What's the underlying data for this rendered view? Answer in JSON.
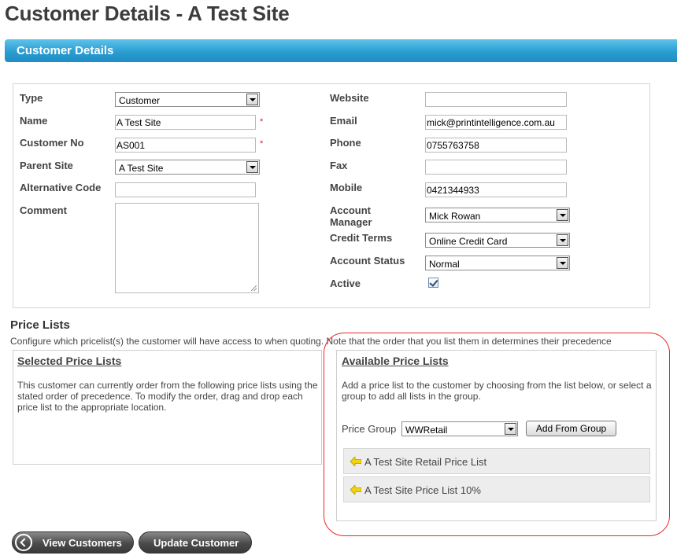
{
  "page": {
    "title": "Customer Details - A Test Site"
  },
  "section": {
    "title": "Customer Details"
  },
  "form": {
    "type": {
      "label": "Type",
      "value": "Customer"
    },
    "name": {
      "label": "Name",
      "value": "A Test Site",
      "required_mark": "*"
    },
    "customer_no": {
      "label": "Customer No",
      "value": "AS001",
      "required_mark": "*"
    },
    "parent_site": {
      "label": "Parent Site",
      "value": "A Test Site"
    },
    "alternative_code": {
      "label": "Alternative Code",
      "value": ""
    },
    "comment": {
      "label": "Comment",
      "value": ""
    },
    "website": {
      "label": "Website",
      "value": ""
    },
    "email": {
      "label": "Email",
      "value": "mick@printintelligence.com.au"
    },
    "phone": {
      "label": "Phone",
      "value": "0755763758"
    },
    "fax": {
      "label": "Fax",
      "value": ""
    },
    "mobile": {
      "label": "Mobile",
      "value": "0421344933"
    },
    "account_manager": {
      "label": "Account Manager",
      "value": "Mick Rowan"
    },
    "credit_terms": {
      "label": "Credit Terms",
      "value": "Online Credit Card"
    },
    "account_status": {
      "label": "Account Status",
      "value": "Normal"
    },
    "active": {
      "label": "Active",
      "checked": true
    }
  },
  "price_lists": {
    "heading": "Price Lists",
    "description": "Configure which pricelist(s) the customer will have access to when quoting. Note that the order that you list them in determines their precedence",
    "selected": {
      "title": "Selected Price Lists",
      "text": "This customer can currently order from the following price lists using the stated order of precedence. To modify the order, drag and drop each price list to the appropriate location."
    },
    "available": {
      "title": "Available Price Lists",
      "text": "Add a price list to the customer by choosing from the list below, or select a group to add all lists in the group.",
      "group_label": "Price Group",
      "group_value": "WWRetail",
      "add_button": "Add From Group",
      "items": [
        {
          "label": "A Test Site Retail Price List"
        },
        {
          "label": "A Test Site Price List 10%"
        }
      ]
    }
  },
  "buttons": {
    "view_customers": "View Customers",
    "update_customer": "Update Customer"
  },
  "colors": {
    "section_bar": "#2a9dd1",
    "highlight_oval": "#e42a2a",
    "arrow_icon": "#f2d40e"
  }
}
